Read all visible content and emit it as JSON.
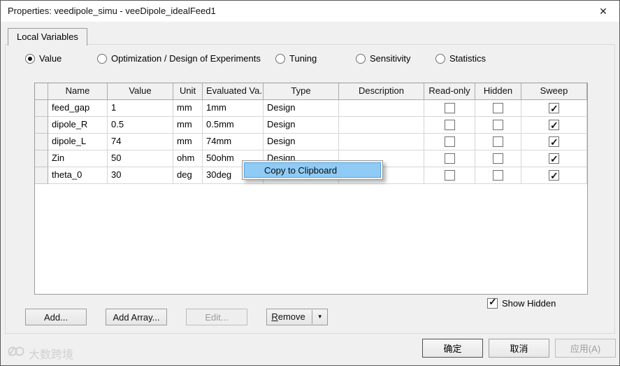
{
  "window": {
    "title": "Properties: veedipole_simu - veeDipole_idealFeed1",
    "close_glyph": "✕"
  },
  "tab": {
    "label": "Local Variables"
  },
  "radio_options": [
    {
      "label": "Value",
      "selected": true
    },
    {
      "label": "Optimization / Design of Experiments",
      "selected": false
    },
    {
      "label": "Tuning",
      "selected": false
    },
    {
      "label": "Sensitivity",
      "selected": false
    },
    {
      "label": "Statistics",
      "selected": false
    }
  ],
  "table": {
    "columns": [
      "",
      "Name",
      "Value",
      "Unit",
      "Evaluated Va...",
      "Type",
      "Description",
      "Read-only",
      "Hidden",
      "Sweep"
    ],
    "rows": [
      {
        "name": "feed_gap",
        "value": "1",
        "unit": "mm",
        "evaluated": "1mm",
        "type": "Design",
        "description": "",
        "read_only": false,
        "hidden": false,
        "sweep": true
      },
      {
        "name": "dipole_R",
        "value": "0.5",
        "unit": "mm",
        "evaluated": "0.5mm",
        "type": "Design",
        "description": "",
        "read_only": false,
        "hidden": false,
        "sweep": true
      },
      {
        "name": "dipole_L",
        "value": "74",
        "unit": "mm",
        "evaluated": "74mm",
        "type": "Design",
        "description": "",
        "read_only": false,
        "hidden": false,
        "sweep": true
      },
      {
        "name": "Zin",
        "value": "50",
        "unit": "ohm",
        "evaluated": "50ohm",
        "type": "Design",
        "description": "",
        "read_only": false,
        "hidden": false,
        "sweep": true
      },
      {
        "name": "theta_0",
        "value": "30",
        "unit": "deg",
        "evaluated": "30deg",
        "type": "Design",
        "description": "",
        "read_only": false,
        "hidden": false,
        "sweep": true
      }
    ]
  },
  "context_menu": {
    "items": [
      {
        "label": "Copy to Clipboard",
        "highlighted": true
      }
    ]
  },
  "show_hidden": {
    "label": "Show Hidden",
    "checked": true
  },
  "actions": {
    "add": "Add...",
    "add_array": "Add Array...",
    "edit": "Edit...",
    "remove": {
      "accel": "R",
      "rest": "emove",
      "dropdown_glyph": "▼"
    }
  },
  "dialog_buttons": {
    "ok": "确定",
    "cancel": "取消",
    "apply": "应用(A)"
  },
  "watermark": {
    "text": "大数跨境"
  },
  "colors": {
    "titlebar_bg": "#ffffff",
    "dialog_bg": "#f0f0f0",
    "menu_highlight": "#8fcbf5",
    "menu_highlight_border": "#5aa3dc",
    "grid_header_bg": "#f1f1f1"
  }
}
